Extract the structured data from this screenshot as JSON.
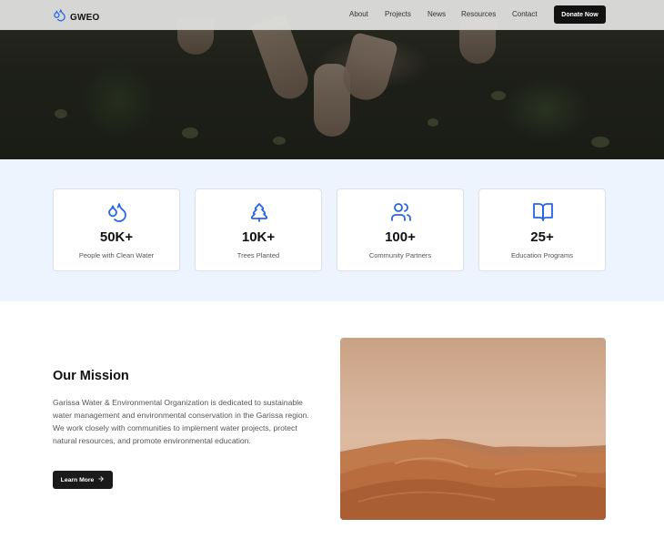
{
  "nav": {
    "brand": "GWEO",
    "links": [
      "About",
      "Projects",
      "News",
      "Resources",
      "Contact"
    ],
    "cta": "Donate Now"
  },
  "stats": [
    {
      "icon": "droplets-icon",
      "value": "50K+",
      "label": "People with Clean Water"
    },
    {
      "icon": "tree-icon",
      "value": "10K+",
      "label": "Trees Planted"
    },
    {
      "icon": "users-icon",
      "value": "100+",
      "label": "Community Partners"
    },
    {
      "icon": "book-open-icon",
      "value": "25+",
      "label": "Education Programs"
    }
  ],
  "mission": {
    "title": "Our Mission",
    "text": "Garissa Water & Environmental Organization is dedicated to sustainable water management and environmental conservation in the Garissa region. We work closely with communities to implement water projects, protect natural resources, and promote environmental education.",
    "button": "Learn More"
  },
  "colors": {
    "accent": "#2563eb",
    "dark": "#111111",
    "stats_bg": "#eef4fd"
  }
}
